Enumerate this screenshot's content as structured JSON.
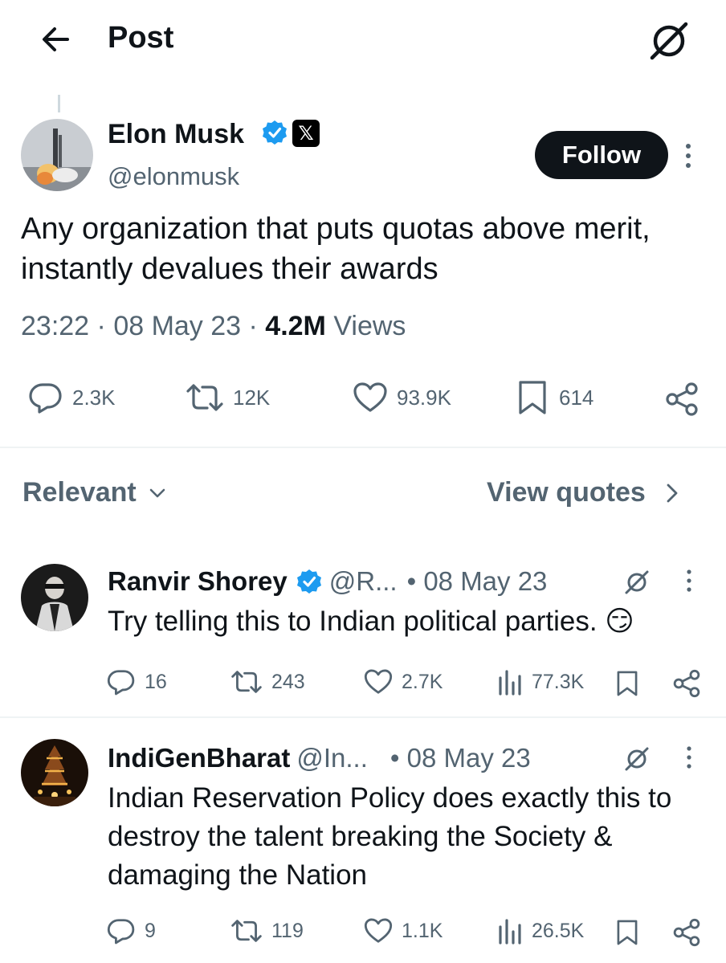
{
  "header": {
    "title": "Post"
  },
  "main_tweet": {
    "author_name": "Elon Musk",
    "handle": "@elonmusk",
    "x_badge": "𝕏",
    "follow_label": "Follow",
    "text": "Any organization that puts quotas above merit, instantly devalues their awards",
    "time": "23:22",
    "date": "08 May 23",
    "views_count": "4.2M",
    "views_label": "Views",
    "separator": " · ",
    "replies": "2.3K",
    "reposts": "12K",
    "likes": "93.9K",
    "bookmarks": "614"
  },
  "sort": {
    "label": "Relevant",
    "quotes_label": "View quotes"
  },
  "replies": [
    {
      "name": "Ranvir Shorey",
      "handle": "@R...",
      "date": "• 08 May 23",
      "text": "Try telling this to Indian political parties. 😏",
      "replies": "16",
      "reposts": "243",
      "likes": "2.7K",
      "views": "77.3K"
    },
    {
      "name": "IndiGenBharat",
      "handle": "@In...",
      "date": "• 08 May 23",
      "text": "Indian Reservation Policy does exactly this to destroy the talent breaking the Society & damaging the Nation",
      "replies": "9",
      "reposts": "119",
      "likes": "1.1K",
      "views": "26.5K"
    }
  ],
  "colors": {
    "text": "#0f1419",
    "muted": "#536471",
    "verified": "#1d9bf0",
    "divider": "#eff3f4"
  }
}
